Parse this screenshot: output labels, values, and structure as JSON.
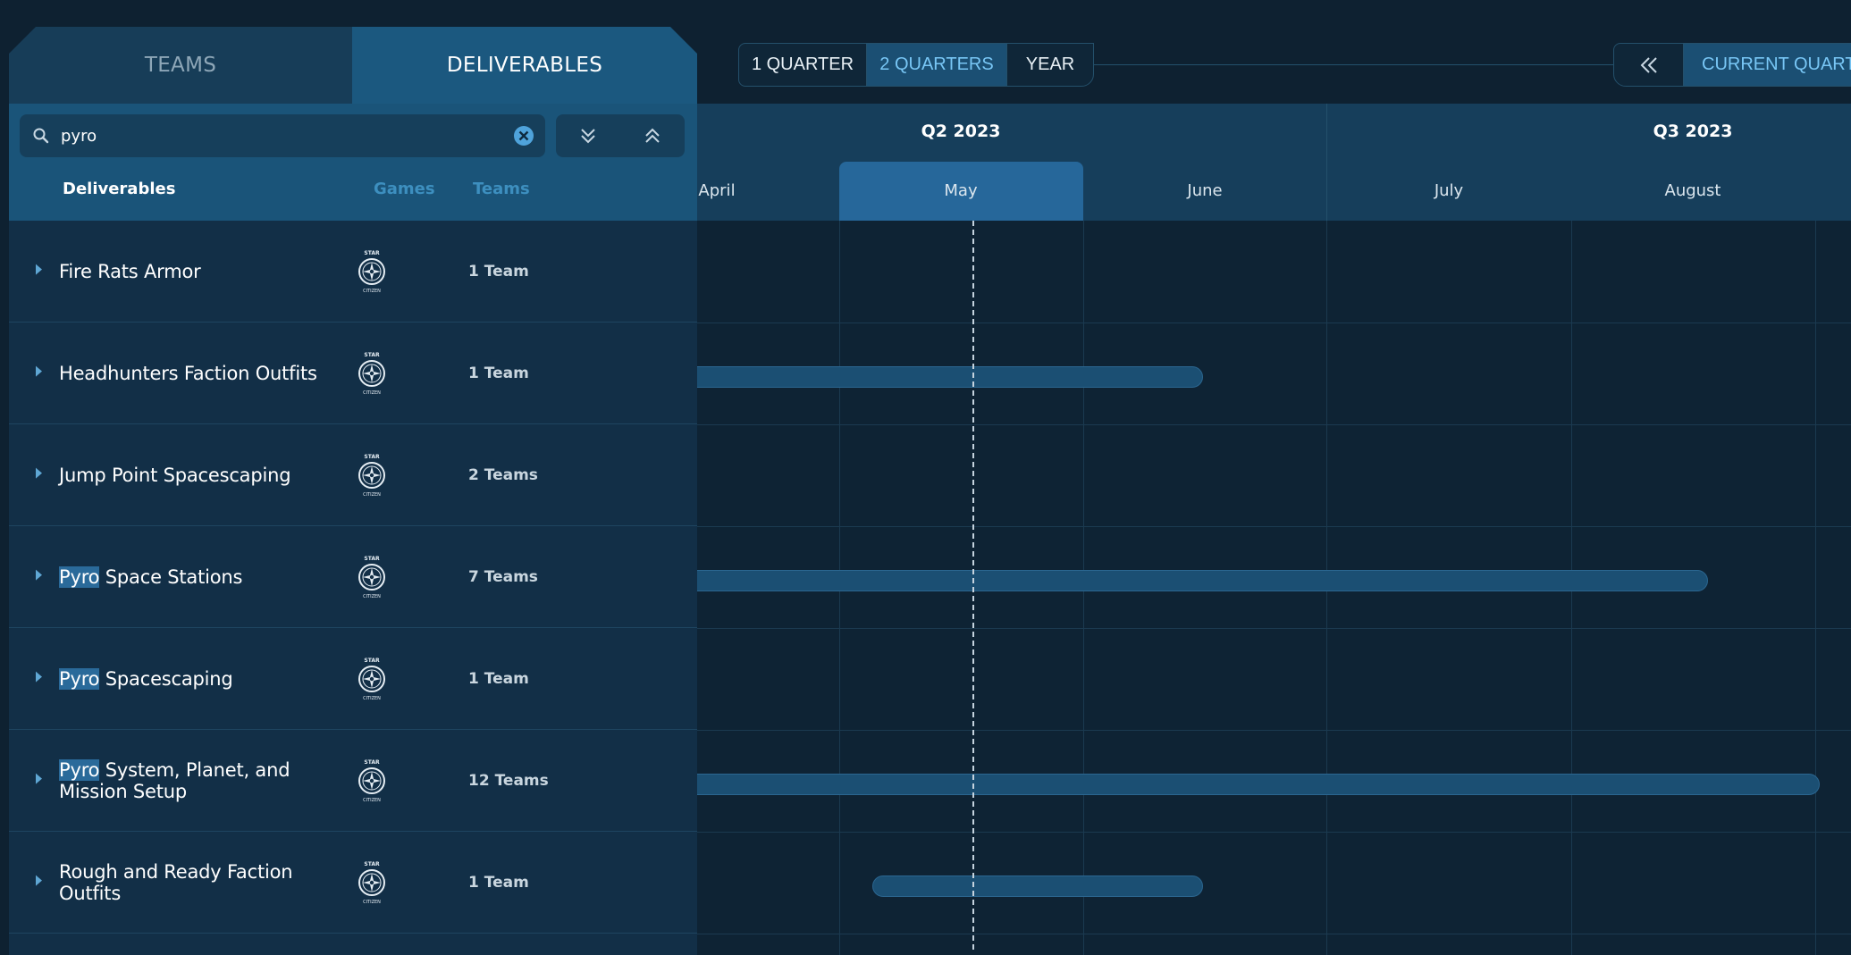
{
  "tabs": {
    "teams": "TEAMS",
    "deliverables": "DELIVERABLES"
  },
  "search": {
    "value": "pyro"
  },
  "columns": {
    "deliverables": "Deliverables",
    "games": "Games",
    "teams": "Teams"
  },
  "period": {
    "one_quarter": "1 QUARTER",
    "two_quarters": "2 QUARTERS",
    "year": "YEAR",
    "selected": "2 QUARTERS"
  },
  "nav": {
    "current_quarter": "CURRENT QUARTER"
  },
  "timeline": {
    "quarters": [
      "Q2 2023",
      "Q3 2023"
    ],
    "months": [
      "April",
      "May",
      "June",
      "July",
      "August"
    ],
    "current_month": "May"
  },
  "rows": [
    {
      "pre": "",
      "highlight": "",
      "post": "Fire Rats Armor",
      "teams": "1 Team"
    },
    {
      "pre": "",
      "highlight": "",
      "post": "Headhunters Faction Outfits",
      "teams": "1 Team"
    },
    {
      "pre": "",
      "highlight": "",
      "post": "Jump Point Spacescaping",
      "teams": "2 Teams"
    },
    {
      "pre": "",
      "highlight": "Pyro",
      "post": " Space Stations",
      "teams": "7 Teams"
    },
    {
      "pre": "",
      "highlight": "Pyro",
      "post": " Spacescaping",
      "teams": "1 Team"
    },
    {
      "pre": "",
      "highlight": "Pyro",
      "post": " System, Planet, and Mission Setup",
      "teams": "12 Teams"
    },
    {
      "pre": "",
      "highlight": "",
      "post": "Rough and Ready Faction Outfits",
      "teams": "1 Team"
    }
  ],
  "game_logo": {
    "top": "STAR",
    "bottom": "CITIZEN"
  },
  "colors": {
    "background": "#0e2131",
    "panel": "#122f47",
    "accent": "#1b4f73",
    "highlight": "#2a6a9a",
    "active_text": "#78c6f5"
  },
  "icons": [
    "search-icon",
    "clear-icon",
    "expand-all-icon",
    "collapse-all-icon",
    "double-chevron-left-icon",
    "caret-right-icon",
    "star-citizen-logo"
  ]
}
